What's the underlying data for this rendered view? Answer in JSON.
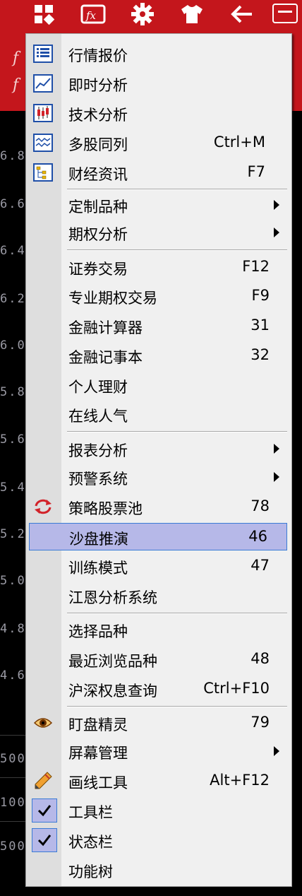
{
  "toolbar": {
    "icons": [
      "grid-icon",
      "formula-icon",
      "gear-icon",
      "shirt-icon",
      "back-arrow-icon",
      "minimize-icon"
    ]
  },
  "background": {
    "left_numbers": [
      "6.8",
      "6.6",
      "6.4",
      "6.2",
      "6.0",
      "5.8",
      "5.6",
      "5.4",
      "5.2",
      "5.0",
      "4.8",
      "4.6",
      "500",
      "100",
      "500"
    ]
  },
  "menu": {
    "items": [
      {
        "label": "行情报价",
        "shortcut": "",
        "icon": "quote-table-icon"
      },
      {
        "label": "即时分析",
        "shortcut": "",
        "icon": "line-chart-icon"
      },
      {
        "label": "技术分析",
        "shortcut": "",
        "icon": "candlestick-icon"
      },
      {
        "label": "多股同列",
        "shortcut": "Ctrl+M",
        "icon": "multi-chart-icon"
      },
      {
        "label": "财经资讯",
        "shortcut": "F7",
        "icon": "news-tree-icon"
      },
      {
        "label": "定制品种",
        "shortcut": "",
        "submenu": true
      },
      {
        "label": "期权分析",
        "shortcut": "",
        "submenu": true
      },
      {
        "label": "证券交易",
        "shortcut": "F12"
      },
      {
        "label": "专业期权交易",
        "shortcut": "F9"
      },
      {
        "label": "金融计算器",
        "shortcut": "31"
      },
      {
        "label": "金融记事本",
        "shortcut": "32"
      },
      {
        "label": "个人理财",
        "shortcut": ""
      },
      {
        "label": "在线人气",
        "shortcut": ""
      },
      {
        "label": "报表分析",
        "shortcut": "",
        "submenu": true
      },
      {
        "label": "预警系统",
        "shortcut": "",
        "submenu": true
      },
      {
        "label": "策略股票池",
        "shortcut": "78",
        "icon": "refresh-arrows-icon"
      },
      {
        "label": "沙盘推演",
        "shortcut": "46",
        "selected": true
      },
      {
        "label": "训练模式",
        "shortcut": "47"
      },
      {
        "label": "江恩分析系统",
        "shortcut": ""
      },
      {
        "label": "选择品种",
        "shortcut": ""
      },
      {
        "label": "最近浏览品种",
        "shortcut": "48"
      },
      {
        "label": "沪深权息查询",
        "shortcut": "Ctrl+F10"
      },
      {
        "label": "盯盘精灵",
        "shortcut": "79",
        "icon": "eye-icon"
      },
      {
        "label": "屏幕管理",
        "shortcut": "",
        "submenu": true
      },
      {
        "label": "画线工具",
        "shortcut": "Alt+F12",
        "icon": "pencil-icon"
      },
      {
        "label": "工具栏",
        "shortcut": "",
        "checked": true
      },
      {
        "label": "状态栏",
        "shortcut": "",
        "checked": true
      },
      {
        "label": "功能树",
        "shortcut": ""
      }
    ]
  },
  "colors": {
    "red": "#c4161c",
    "menu_bg": "#f0f0f0",
    "selected_bg": "#b6b8e8",
    "selected_border": "#3a7bd5"
  }
}
